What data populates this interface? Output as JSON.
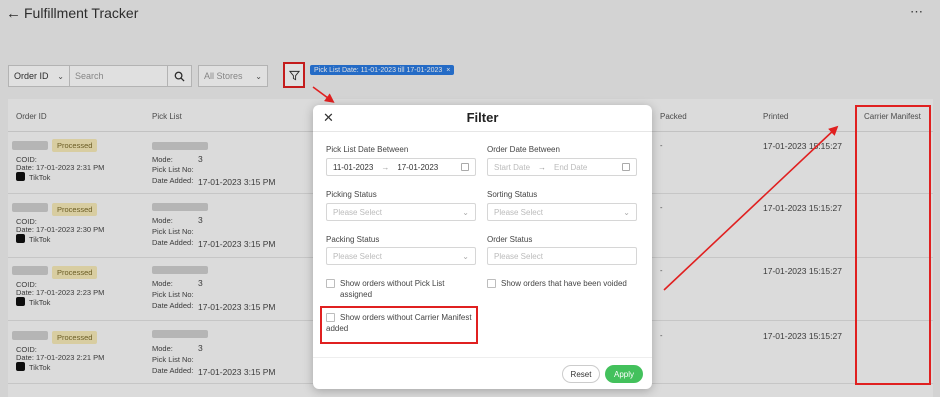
{
  "app": {
    "title": "Fulfillment Tracker",
    "back_icon": "back-arrow-icon",
    "more_icon": "more-dots-icon"
  },
  "toolbar": {
    "search_by": "Order ID",
    "search_placeholder": "Search",
    "stores": "All Stores",
    "active_filter": "Pick List Date: 11-01-2023 till 17-01-2023"
  },
  "table": {
    "columns": [
      "Order ID",
      "Pick List",
      "Packed",
      "Printed",
      "Carrier Manifest"
    ],
    "rows": [
      {
        "status": "Processed",
        "coid_label": "COID:",
        "date": "Date: 17-01-2023 2:31 PM",
        "channel": "TikTok",
        "mode_label": "Mode:",
        "mode": "3",
        "pick_list_no_label": "Pick List No:",
        "date_added_label": "Date Added:",
        "date_added": "17-01-2023 3:15 PM",
        "packed": "-",
        "printed": "17-01-2023 15:15:27"
      },
      {
        "status": "Processed",
        "coid_label": "COID:",
        "date": "Date: 17-01-2023 2:30 PM",
        "channel": "TikTok",
        "mode_label": "Mode:",
        "mode": "3",
        "pick_list_no_label": "Pick List No:",
        "date_added_label": "Date Added:",
        "date_added": "17-01-2023 3:15 PM",
        "packed": "-",
        "printed": "17-01-2023 15:15:27"
      },
      {
        "status": "Processed",
        "coid_label": "COID:",
        "date": "Date: 17-01-2023 2:23 PM",
        "channel": "TikTok",
        "mode_label": "Mode:",
        "mode": "3",
        "pick_list_no_label": "Pick List No:",
        "date_added_label": "Date Added:",
        "date_added": "17-01-2023 3:15 PM",
        "packed": "-",
        "printed": "17-01-2023 15:15:27"
      },
      {
        "status": "Processed",
        "coid_label": "COID:",
        "date": "Date: 17-01-2023 2:21 PM",
        "channel": "TikTok",
        "mode_label": "Mode:",
        "mode": "3",
        "pick_list_no_label": "Pick List No:",
        "date_added_label": "Date Added:",
        "date_added": "17-01-2023 3:15 PM",
        "packed": "-",
        "printed": "17-01-2023 15:15:27"
      }
    ]
  },
  "filter": {
    "title": "Filter",
    "pick_list_date_label": "Pick List Date Between",
    "pick_list_start": "11-01-2023",
    "pick_list_end": "17-01-2023",
    "order_date_label": "Order Date Between",
    "order_start_placeholder": "Start Date",
    "order_end_placeholder": "End Date",
    "picking_status_label": "Picking Status",
    "sorting_status_label": "Sorting Status",
    "packing_status_label": "Packing Status",
    "order_status_label": "Order Status",
    "select_placeholder": "Please Select",
    "chk_no_picklist": "Show orders without Pick List assigned",
    "chk_voided": "Show orders that have been voided",
    "chk_no_manifest": "Show orders without Carrier Manifest added",
    "reset": "Reset",
    "apply": "Apply"
  },
  "colors": {
    "accent_green": "#43c15c",
    "chip_blue": "#2a7ae2",
    "highlight_red": "#e02020",
    "badge_yellow": "#f6eab8"
  }
}
